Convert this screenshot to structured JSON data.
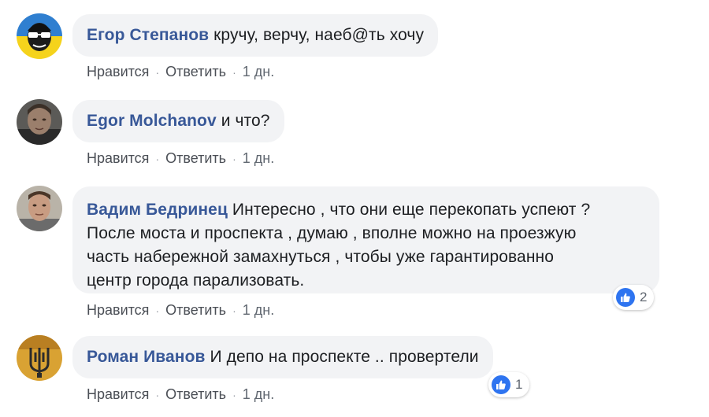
{
  "comments": [
    {
      "author": "Егор Степанов",
      "text": "кручу, верчу, наеб@ть хочу",
      "like_label": "Нравится",
      "reply_label": "Ответить",
      "time": "1 дн.",
      "avatar_icon": "masked-face-avatar"
    },
    {
      "author": "Egor Molchanov",
      "text": "и что?",
      "like_label": "Нравится",
      "reply_label": "Ответить",
      "time": "1 дн.",
      "avatar_icon": "profile-photo-avatar"
    },
    {
      "author": "Вадим Бедринец",
      "text": "Интересно , что они еще перекопать успеют ?\nПосле моста и проспекта , думаю , вполне можно на проезжую\nчасть набережной замахнуться , чтобы уже гарантированно\nцентр города парализовать.",
      "like_label": "Нравится",
      "reply_label": "Ответить",
      "time": "1 дн.",
      "reaction_count": "2",
      "avatar_icon": "profile-photo-avatar"
    },
    {
      "author": "Роман Иванов",
      "text": "И депо на проспекте .. провертели",
      "like_label": "Нравится",
      "reply_label": "Ответить",
      "time": "1 дн.",
      "reaction_count": "1",
      "avatar_icon": "trident-emblem-avatar"
    }
  ],
  "colors": {
    "author_link": "#385898",
    "bubble_bg": "#f2f3f5",
    "like_badge": "#2e74f0",
    "action_text": "#606770"
  }
}
